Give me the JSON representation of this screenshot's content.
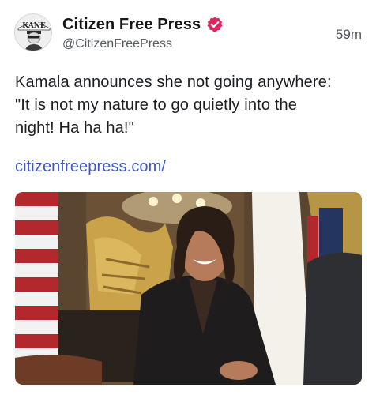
{
  "post": {
    "author": {
      "display_name": "Citizen Free Press",
      "handle": "@CitizenFreePress",
      "avatar_text": "KANE",
      "verified_icon": "verified-badge-icon",
      "verified_color": "#e0245e"
    },
    "timestamp": "59m",
    "text": "Kamala announces she not going anywhere:\n\"It is not my nature to go quietly into the\nnight! Ha ha ha!\"",
    "link": "citizenfreepress.com/",
    "link_color": "#3b56c9",
    "media": {
      "kind": "photo"
    }
  }
}
